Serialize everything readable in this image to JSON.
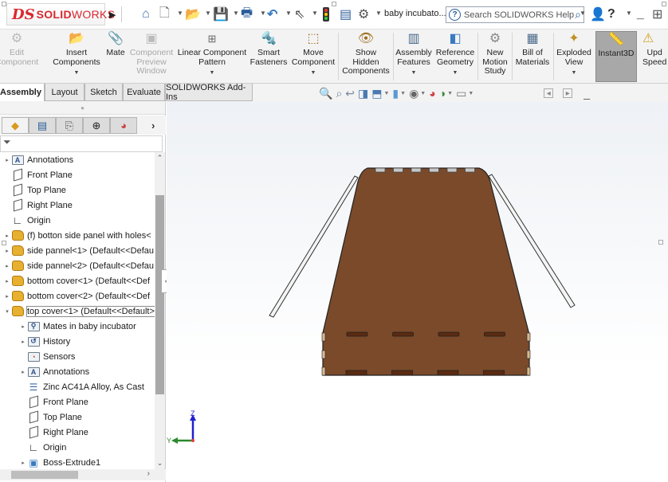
{
  "app": {
    "logo_ds": "DS",
    "logo_solid": "SOLID",
    "logo_works": "WORKS",
    "document_title": "baby incubato...",
    "search_placeholder": "Search SOLIDWORKS Help",
    "brand_color": "#d9282f"
  },
  "quick_access": [
    {
      "name": "home",
      "icon": "home-icon"
    },
    {
      "name": "new",
      "icon": "new-document-icon"
    },
    {
      "name": "open",
      "icon": "open-folder-icon"
    },
    {
      "name": "save",
      "icon": "save-icon"
    },
    {
      "name": "print",
      "icon": "print-icon"
    },
    {
      "name": "undo",
      "icon": "undo-icon"
    },
    {
      "name": "select",
      "icon": "select-cursor-icon"
    },
    {
      "name": "rebuild",
      "icon": "rebuild-traffic-light-icon"
    },
    {
      "name": "file-properties",
      "icon": "file-properties-icon"
    },
    {
      "name": "options",
      "icon": "gear-icon"
    }
  ],
  "ribbon": [
    {
      "label": "Edit\nComponent",
      "icon": "edit-component-icon",
      "disabled": true,
      "dropdown": false
    },
    {
      "label": "Insert\nComponents",
      "icon": "insert-components-icon",
      "disabled": false,
      "dropdown": true
    },
    {
      "label": "Mate",
      "icon": "paperclip-icon",
      "disabled": false,
      "dropdown": false
    },
    {
      "label": "Component\nPreview\nWindow",
      "icon": "component-preview-icon",
      "disabled": true,
      "dropdown": false
    },
    {
      "label": "Linear Component\nPattern",
      "icon": "linear-pattern-icon",
      "disabled": false,
      "dropdown": true
    },
    {
      "label": "Smart\nFasteners",
      "icon": "smart-fasteners-icon",
      "disabled": false,
      "dropdown": false
    },
    {
      "label": "Move\nComponent",
      "icon": "move-component-icon",
      "disabled": false,
      "dropdown": true
    },
    {
      "label": "Show\nHidden\nComponents",
      "icon": "show-hidden-icon",
      "disabled": false,
      "dropdown": false
    },
    {
      "label": "Assembly\nFeatures",
      "icon": "assembly-features-icon",
      "disabled": false,
      "dropdown": true
    },
    {
      "label": "Reference\nGeometry",
      "icon": "reference-geometry-icon",
      "disabled": false,
      "dropdown": true
    },
    {
      "label": "New\nMotion\nStudy",
      "icon": "motion-study-icon",
      "disabled": false,
      "dropdown": false
    },
    {
      "label": "Bill of\nMaterials",
      "icon": "bom-icon",
      "disabled": false,
      "dropdown": false
    },
    {
      "label": "Exploded\nView",
      "icon": "exploded-view-icon",
      "disabled": false,
      "dropdown": true
    },
    {
      "label": "Instant3D",
      "icon": "instant3d-ruler-icon",
      "disabled": false,
      "dropdown": false,
      "active": true
    },
    {
      "label": "Upd\nSpeed",
      "icon": "update-speedpak-icon",
      "disabled": false,
      "dropdown": false
    }
  ],
  "tabs": [
    {
      "label": "Assembly",
      "active": true
    },
    {
      "label": "Layout",
      "active": false
    },
    {
      "label": "Sketch",
      "active": false
    },
    {
      "label": "Evaluate",
      "active": false
    },
    {
      "label": "SOLIDWORKS Add-Ins",
      "active": false
    }
  ],
  "tree": [
    {
      "label": "Annotations",
      "icon": "annotations-folder-icon",
      "level": 0,
      "expander": true
    },
    {
      "label": "Front Plane",
      "icon": "plane-icon",
      "level": 0,
      "expander": false
    },
    {
      "label": "Top Plane",
      "icon": "plane-icon",
      "level": 0,
      "expander": false
    },
    {
      "label": "Right Plane",
      "icon": "plane-icon",
      "level": 0,
      "expander": false
    },
    {
      "label": "Origin",
      "icon": "origin-icon",
      "level": 0,
      "expander": false
    },
    {
      "label": "(f) botton side panel with holes<",
      "icon": "part-icon",
      "level": 0,
      "expander": true
    },
    {
      "label": "side pannel<1> (Default<<Defau",
      "icon": "part-icon",
      "level": 0,
      "expander": true
    },
    {
      "label": "side pannel<2> (Default<<Defau",
      "icon": "part-icon",
      "level": 0,
      "expander": true
    },
    {
      "label": "bottom cover<1> (Default<<Def",
      "icon": "part-icon",
      "level": 0,
      "expander": true
    },
    {
      "label": "bottom cover<2> (Default<<Def",
      "icon": "part-icon",
      "level": 0,
      "expander": true
    },
    {
      "label": "top cover<1> (Default<<Default>",
      "icon": "part-icon",
      "level": 0,
      "expander": true,
      "expanded": true,
      "selected": true
    },
    {
      "label": "Mates in baby incubator",
      "icon": "mates-folder-icon",
      "level": 1,
      "expander": true
    },
    {
      "label": "History",
      "icon": "history-folder-icon",
      "level": 1,
      "expander": true
    },
    {
      "label": "Sensors",
      "icon": "sensors-folder-icon",
      "level": 1,
      "expander": false
    },
    {
      "label": "Annotations",
      "icon": "annotations-folder-icon",
      "level": 1,
      "expander": true
    },
    {
      "label": "Zinc AC41A Alloy, As Cast",
      "icon": "material-icon",
      "level": 1,
      "expander": false
    },
    {
      "label": "Front Plane",
      "icon": "plane-icon",
      "level": 1,
      "expander": false
    },
    {
      "label": "Top Plane",
      "icon": "plane-icon",
      "level": 1,
      "expander": false
    },
    {
      "label": "Right Plane",
      "icon": "plane-icon",
      "level": 1,
      "expander": false
    },
    {
      "label": "Origin",
      "icon": "origin-icon",
      "level": 1,
      "expander": false
    },
    {
      "label": "Boss-Extrude1",
      "icon": "boss-extrude-icon",
      "level": 1,
      "expander": true
    }
  ],
  "triad": {
    "z_label": "Z",
    "y_label": "Y"
  },
  "model": {
    "panel_color": "#7a4a2a",
    "slot_color": "#5a2a10",
    "tab_color": "#d8b890",
    "rod_color": "#f4f4f4"
  }
}
